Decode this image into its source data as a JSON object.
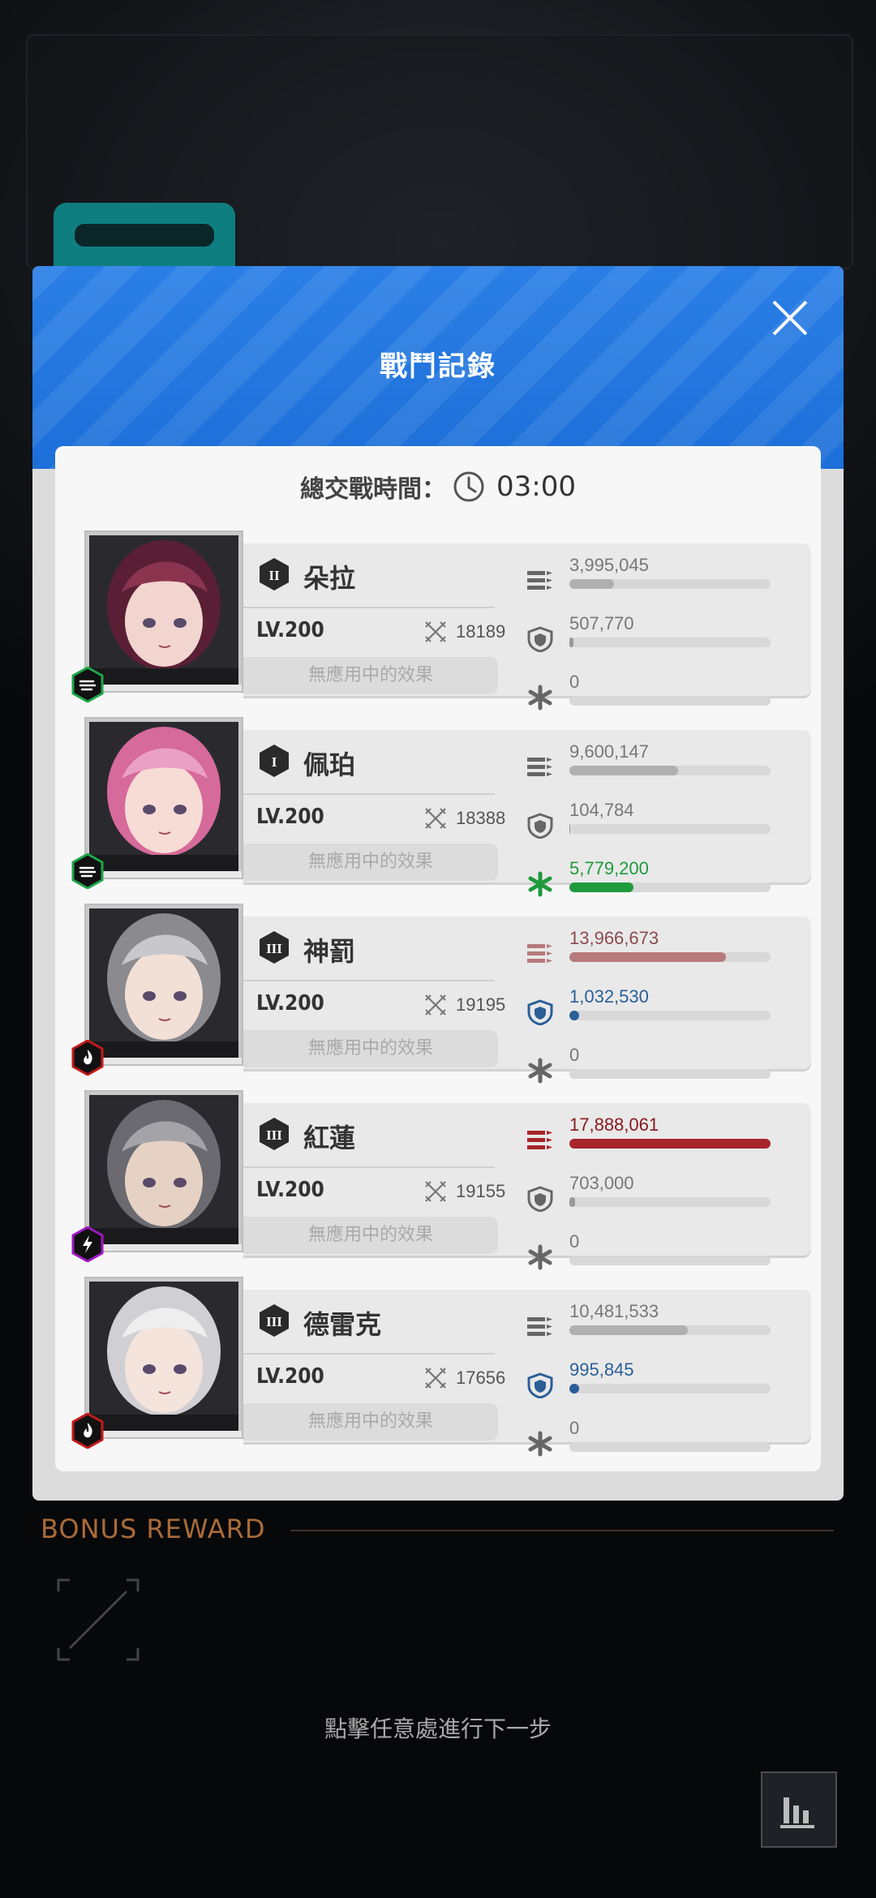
{
  "panel": {
    "title": "戰鬥記錄",
    "total_label": "總交戰時間：",
    "total_time": "03:00"
  },
  "characters": [
    {
      "name": "朵拉",
      "rank": "II",
      "level": "LV.200",
      "power": "18189",
      "effect": "無應用中的效果",
      "element": "wind",
      "damage": "3,995,045",
      "damage_pct": 0.22,
      "shield": "507,770",
      "shield_pct": 0.02,
      "heal": "0",
      "heal_pct": 0
    },
    {
      "name": "佩珀",
      "rank": "I",
      "level": "LV.200",
      "power": "18388",
      "effect": "無應用中的效果",
      "element": "wind",
      "damage": "9,600,147",
      "damage_pct": 0.54,
      "shield": "104,784",
      "shield_pct": 0.005,
      "heal": "5,779,200",
      "heal_pct": 0.32
    },
    {
      "name": "神罰",
      "rank": "III",
      "level": "LV.200",
      "power": "19195",
      "effect": "無應用中的效果",
      "element": "fire",
      "damage": "13,966,673",
      "damage_pct": 0.78,
      "shield": "1,032,530",
      "shield_pct": 0.05,
      "heal": "0",
      "heal_pct": 0
    },
    {
      "name": "紅蓮",
      "rank": "III",
      "level": "LV.200",
      "power": "19155",
      "effect": "無應用中的效果",
      "element": "electric",
      "damage": "17,888,061",
      "damage_pct": 1.0,
      "shield": "703,000",
      "shield_pct": 0.03,
      "heal": "0",
      "heal_pct": 0
    },
    {
      "name": "德雷克",
      "rank": "III",
      "level": "LV.200",
      "power": "17656",
      "effect": "無應用中的效果",
      "element": "fire",
      "damage": "10,481,533",
      "damage_pct": 0.59,
      "shield": "995,845",
      "shield_pct": 0.05,
      "heal": "0",
      "heal_pct": 0
    }
  ],
  "bonus": {
    "label": "BONUS REWARD"
  },
  "hint": "點擊任意處進行下一步",
  "colors": {
    "header_blue": "#1c6fd8",
    "teal": "#0f7e80",
    "damage_gray": "#b0b0b0",
    "damage_rose": "#b6797c",
    "damage_red": "#a8242b",
    "shield_blue": "#2a5f98",
    "heal_green": "#1e9a3c",
    "bonus_orange": "#a96b39"
  },
  "icons": {
    "close": "close-icon",
    "clock": "clock-icon",
    "damage": "ammo-icon",
    "shield": "shield-icon",
    "heal": "heal-icon",
    "power": "crossed-swords-icon",
    "wind": "wind-element-icon",
    "fire": "fire-element-icon",
    "electric": "electric-element-icon",
    "stats": "bar-chart-icon"
  }
}
